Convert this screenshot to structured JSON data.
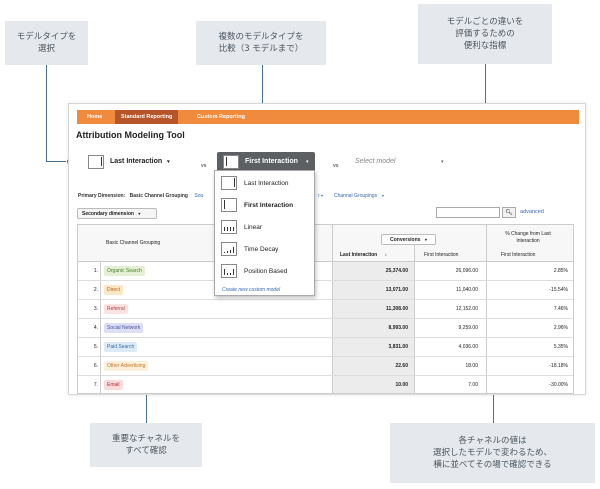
{
  "callouts": {
    "select_model": [
      "モデルタイプを",
      "選択"
    ],
    "compare_models": [
      "複数のモデルタイプを",
      "比較（3 モデルまで）"
    ],
    "metrics": [
      "モデルごとの違いを",
      "評価するための",
      "便利な指標"
    ],
    "channels": [
      "重要なチャネルを",
      "すべて確認"
    ],
    "values": [
      "各チャネルの値は",
      "選択したモデルで変わるため、",
      "横に並べてその場で確認できる"
    ]
  },
  "nav": {
    "tabs": [
      "Home",
      "Standard Reporting",
      "Custom Reporting"
    ],
    "active_tab": "Standard Reporting"
  },
  "page": {
    "title": "Attribution Modeling Tool"
  },
  "models": {
    "first": "Last Interaction",
    "second": "First Interaction",
    "third_placeholder": "Select model",
    "vs": "vs",
    "dropdown_options": [
      "Last Interaction",
      "First Interaction",
      "Linear",
      "Time Decay",
      "Position Based"
    ],
    "dropdown_selected": "First Interaction",
    "create_link": "Create new custom model"
  },
  "dimensions": {
    "primary_label": "Primary Dimension:",
    "primary_value": "Basic Channel Grouping",
    "source_partial": "Sou",
    "r_partial": "r",
    "channel_groupings": "Channel Groupings"
  },
  "controls": {
    "secondary_dimension": "Secondary dimension",
    "advanced": "advanced"
  },
  "table": {
    "header_dimension": "Basic Channel Grouping",
    "conversions_button": "Conversions",
    "change_header": [
      "% Change from Last",
      "Interaction"
    ],
    "col_last": "Last Interaction",
    "col_first": "First Interaction",
    "col_first_change": "First Interaction",
    "rows": [
      {
        "num": "1.",
        "channel": "Organic Search",
        "last": "25,374.00",
        "first": "26,096.00",
        "change": "2.85%",
        "bg": "#e4efd6",
        "fg": "#4b7f2a"
      },
      {
        "num": "2.",
        "channel": "Direct",
        "last": "13,071.00",
        "first": "11,040.00",
        "change": "-15.54%",
        "bg": "#fbe7c4",
        "fg": "#b3651e"
      },
      {
        "num": "3.",
        "channel": "Referral",
        "last": "11,308.00",
        "first": "12,152.00",
        "change": "7.46%",
        "bg": "#fbe3e3",
        "fg": "#b33b3b"
      },
      {
        "num": "4.",
        "channel": "Social Network",
        "last": "8,993.00",
        "first": "9,259.00",
        "change": "2.96%",
        "bg": "#dcdff5",
        "fg": "#4b4f9a"
      },
      {
        "num": "5.",
        "channel": "Paid Search",
        "last": "3,831.00",
        "first": "4,036.00",
        "change": "5.35%",
        "bg": "#dce9f7",
        "fg": "#3d6b9f"
      },
      {
        "num": "6.",
        "channel": "Other Advertising",
        "last": "22.60",
        "first": "18.00",
        "change": "-18.18%",
        "bg": "#fdf0d9",
        "fg": "#c4722a"
      },
      {
        "num": "7.",
        "channel": "Email",
        "last": "10.00",
        "first": "7.00",
        "change": "-30.00%",
        "bg": "#fadada",
        "fg": "#b82f2f"
      }
    ]
  }
}
